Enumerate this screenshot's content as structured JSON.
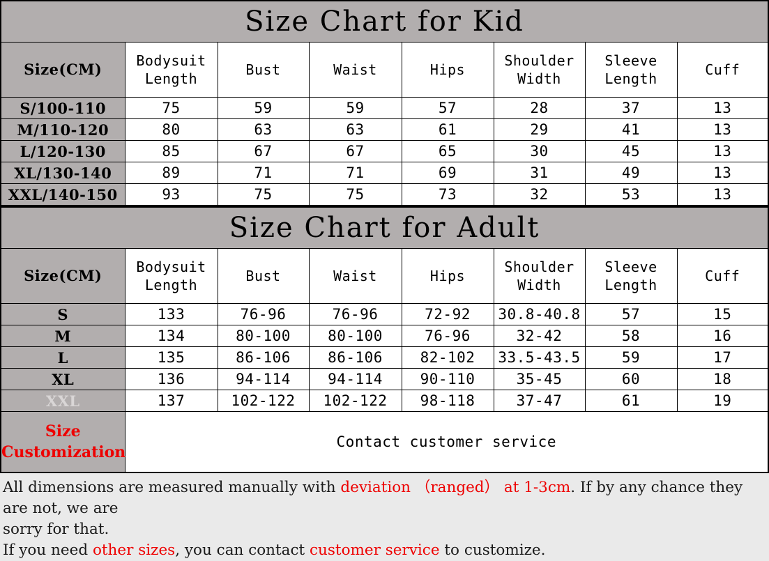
{
  "kid": {
    "title": "Size Chart for Kid",
    "columns": [
      "Size(CM)",
      "Bodysuit Length",
      "Bust",
      "Waist",
      "Hips",
      "Shoulder Width",
      "Sleeve Length",
      "Cuff"
    ],
    "rows": [
      {
        "size": "S/100-110",
        "bodysuit_length": "75",
        "bust": "59",
        "waist": "59",
        "hips": "57",
        "shoulder_width": "28",
        "sleeve_length": "37",
        "cuff": "13"
      },
      {
        "size": "M/110-120",
        "bodysuit_length": "80",
        "bust": "63",
        "waist": "63",
        "hips": "61",
        "shoulder_width": "29",
        "sleeve_length": "41",
        "cuff": "13"
      },
      {
        "size": "L/120-130",
        "bodysuit_length": "85",
        "bust": "67",
        "waist": "67",
        "hips": "65",
        "shoulder_width": "30",
        "sleeve_length": "45",
        "cuff": "13"
      },
      {
        "size": "XL/130-140",
        "bodysuit_length": "89",
        "bust": "71",
        "waist": "71",
        "hips": "69",
        "shoulder_width": "31",
        "sleeve_length": "49",
        "cuff": "13"
      },
      {
        "size": "XXL/140-150",
        "bodysuit_length": "93",
        "bust": "75",
        "waist": "75",
        "hips": "73",
        "shoulder_width": "32",
        "sleeve_length": "53",
        "cuff": "13"
      }
    ]
  },
  "adult": {
    "title": "Size Chart for Adult",
    "columns": [
      "Size(CM)",
      "Bodysuit Length",
      "Bust",
      "Waist",
      "Hips",
      "Shoulder Width",
      "Sleeve Length",
      "Cuff"
    ],
    "rows": [
      {
        "size": "S",
        "bodysuit_length": "133",
        "bust": "76-96",
        "waist": "76-96",
        "hips": "72-92",
        "shoulder_width": "30.8-40.8",
        "sleeve_length": "57",
        "cuff": "15"
      },
      {
        "size": "M",
        "bodysuit_length": "134",
        "bust": "80-100",
        "waist": "80-100",
        "hips": "76-96",
        "shoulder_width": "32-42",
        "sleeve_length": "58",
        "cuff": "16"
      },
      {
        "size": "L",
        "bodysuit_length": "135",
        "bust": "86-106",
        "waist": "86-106",
        "hips": "82-102",
        "shoulder_width": "33.5-43.5",
        "sleeve_length": "59",
        "cuff": "17"
      },
      {
        "size": "XL",
        "bodysuit_length": "136",
        "bust": "94-114",
        "waist": "94-114",
        "hips": "90-110",
        "shoulder_width": "35-45",
        "sleeve_length": "60",
        "cuff": "18"
      },
      {
        "size": "XXL",
        "bodysuit_length": "137",
        "bust": "102-122",
        "waist": "102-122",
        "hips": "98-118",
        "shoulder_width": "37-47",
        "sleeve_length": "61",
        "cuff": "19"
      }
    ],
    "customization": {
      "label_line1": "Size",
      "label_line2": "Customization",
      "value": "Contact customer service",
      "label_color": "#ee0000"
    }
  },
  "notes": {
    "line1_a": "All dimensions are measured manually with ",
    "line1_red1": "deviation",
    "line1_b": " ",
    "line1_red2": "（ranged）",
    "line1_c": " ",
    "line1_red3": "at 1-3cm",
    "line1_d": ". If by any chance they are not, we are",
    "line2": "sorry for that.",
    "line3_a": "If you need ",
    "line3_red1": "other sizes",
    "line3_b": ", you can contact ",
    "line3_red2": "customer service",
    "line3_c": " to customize.",
    "accent_color": "#ee0000"
  },
  "colors": {
    "header_gray": "#b2aeae",
    "page_background": "#eaeaea",
    "cell_background": "#ffffff",
    "border": "#000000",
    "faded_text": "#d9d6d6"
  }
}
